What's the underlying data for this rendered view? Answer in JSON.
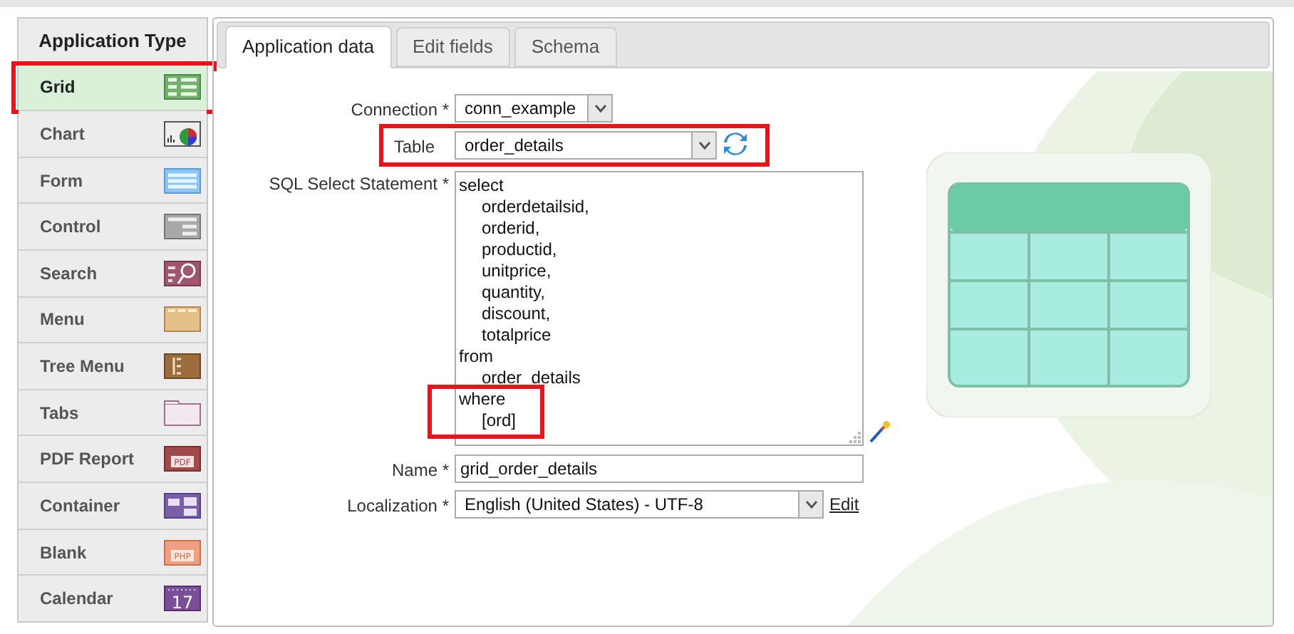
{
  "sidebar": {
    "title": "Application Type",
    "items": [
      {
        "label": "Grid",
        "kind": "grid",
        "selected": true,
        "highlighted": true
      },
      {
        "label": "Chart",
        "kind": "chart",
        "selected": false,
        "highlighted": false
      },
      {
        "label": "Form",
        "kind": "form",
        "selected": false,
        "highlighted": false
      },
      {
        "label": "Control",
        "kind": "control",
        "selected": false,
        "highlighted": false
      },
      {
        "label": "Search",
        "kind": "search",
        "selected": false,
        "highlighted": false
      },
      {
        "label": "Menu",
        "kind": "menu",
        "selected": false,
        "highlighted": false
      },
      {
        "label": "Tree Menu",
        "kind": "tree",
        "selected": false,
        "highlighted": false
      },
      {
        "label": "Tabs",
        "kind": "tabs",
        "selected": false,
        "highlighted": false
      },
      {
        "label": "PDF Report",
        "kind": "pdf",
        "selected": false,
        "highlighted": false,
        "icon_text": "PDF"
      },
      {
        "label": "Container",
        "kind": "container",
        "selected": false,
        "highlighted": false
      },
      {
        "label": "Blank",
        "kind": "blank",
        "selected": false,
        "highlighted": false,
        "icon_text": "PHP"
      },
      {
        "label": "Calendar",
        "kind": "calendar",
        "selected": false,
        "highlighted": false,
        "icon_text": "17"
      }
    ]
  },
  "tabs": [
    {
      "label": "Application data",
      "selected": true
    },
    {
      "label": "Edit fields",
      "selected": false
    },
    {
      "label": "Schema",
      "selected": false
    }
  ],
  "form": {
    "connection": {
      "label": "Connection *",
      "value": "conn_example"
    },
    "table": {
      "label": "Table",
      "value": "order_details",
      "highlighted": true
    },
    "sql": {
      "label": "SQL Select Statement *",
      "lines": [
        {
          "text": "select",
          "indent": false,
          "highlighted": false
        },
        {
          "text": "orderdetailsid,",
          "indent": true,
          "highlighted": false
        },
        {
          "text": "orderid,",
          "indent": true,
          "highlighted": false
        },
        {
          "text": "productid,",
          "indent": true,
          "highlighted": false
        },
        {
          "text": "unitprice,",
          "indent": true,
          "highlighted": false
        },
        {
          "text": "quantity,",
          "indent": true,
          "highlighted": false
        },
        {
          "text": "discount,",
          "indent": true,
          "highlighted": false
        },
        {
          "text": "totalprice",
          "indent": true,
          "highlighted": false
        },
        {
          "text": "from",
          "indent": false,
          "highlighted": false
        },
        {
          "text": "order_details",
          "indent": true,
          "highlighted": false
        },
        {
          "text": "where",
          "indent": false,
          "highlighted": true
        },
        {
          "text": "[ord]",
          "indent": true,
          "highlighted": true
        }
      ]
    },
    "name": {
      "label": "Name *",
      "value": "grid_order_details"
    },
    "localization": {
      "label": "Localization *",
      "value": "English (United States) - UTF-8",
      "link": "Edit"
    }
  }
}
